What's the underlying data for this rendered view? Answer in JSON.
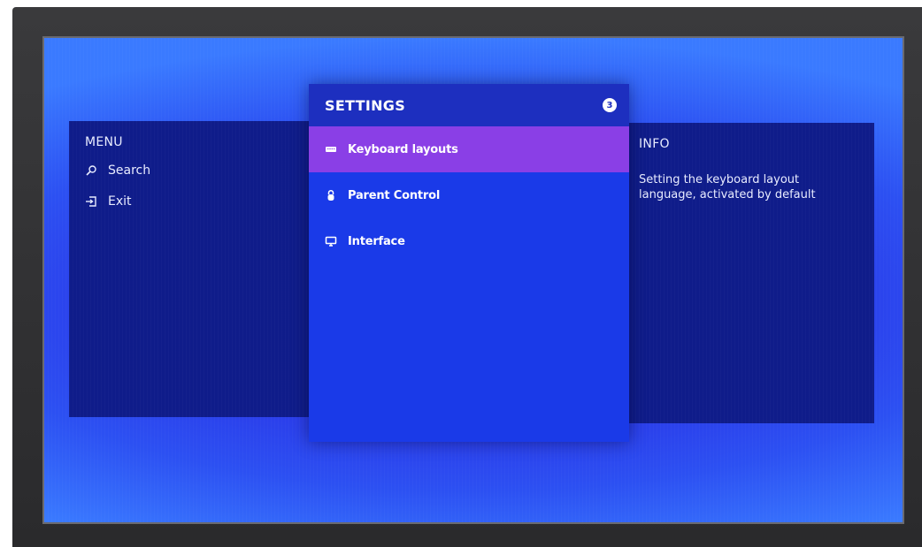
{
  "menu": {
    "heading": "MENU",
    "items": [
      {
        "label": "Search",
        "icon": "search-icon"
      },
      {
        "label": "Exit",
        "icon": "exit-icon"
      }
    ]
  },
  "settings": {
    "title": "SETTINGS",
    "badge": "3",
    "items": [
      {
        "label": "Keyboard layouts",
        "icon": "keyboard-icon",
        "active": true
      },
      {
        "label": "Parent Control",
        "icon": "lock-icon",
        "active": false
      },
      {
        "label": "Interface",
        "icon": "monitor-icon",
        "active": false
      }
    ]
  },
  "info": {
    "heading": "INFO",
    "text": "Setting the keyboard layout language, activated by default"
  },
  "colors": {
    "side_panel": "#0f1c8a",
    "center_panel": "#1a3ae8",
    "active_item": "#8a3fe6"
  }
}
